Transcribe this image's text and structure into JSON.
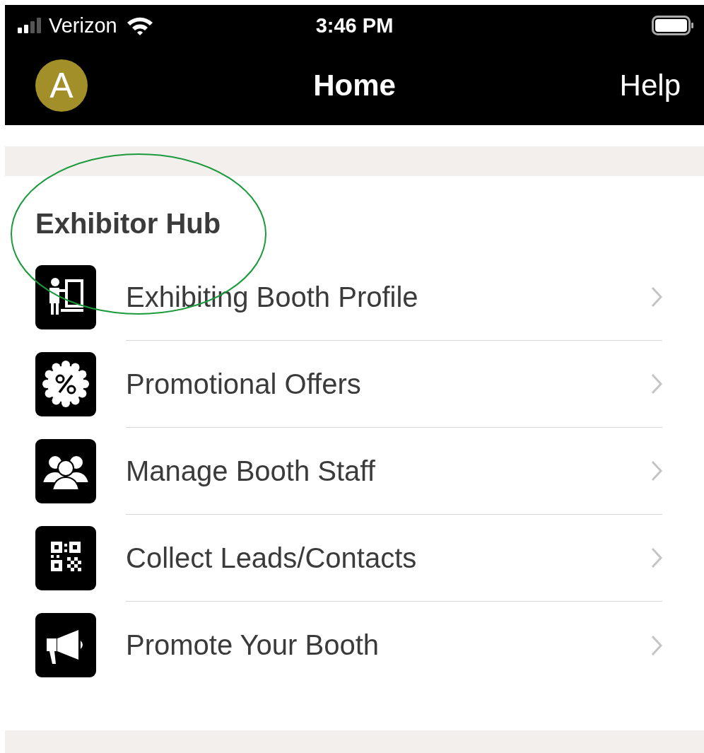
{
  "status_bar": {
    "carrier": "Verizon",
    "time": "3:46 PM"
  },
  "nav_bar": {
    "avatar_letter": "A",
    "title": "Home",
    "help": "Help"
  },
  "section": {
    "title": "Exhibitor Hub",
    "highlighted": true
  },
  "items": [
    {
      "label": "Exhibiting Booth Profile",
      "kind": "presenter"
    },
    {
      "label": "Promotional Offers",
      "kind": "offer"
    },
    {
      "label": "Manage Booth Staff",
      "kind": "staff"
    },
    {
      "label": "Collect Leads/Contacts",
      "kind": "qr"
    },
    {
      "label": "Promote Your Booth",
      "kind": "megaphone"
    }
  ]
}
